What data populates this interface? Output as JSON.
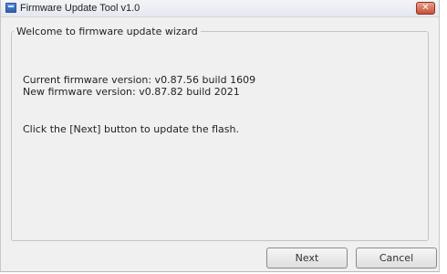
{
  "window": {
    "title": "Firmware Update Tool v1.0",
    "close_symbol": "✕"
  },
  "wizard": {
    "group_title": "Welcome to firmware update wizard",
    "current_version": "Current firmware version: v0.87.56 build 1609",
    "new_version": "New firmware version: v0.87.82 build 2021",
    "instruction": "Click the [Next] button to update the flash."
  },
  "buttons": {
    "next_label": "Next",
    "cancel_label": "Cancel"
  },
  "icons": {
    "app": "app-icon",
    "close": "close-icon"
  }
}
